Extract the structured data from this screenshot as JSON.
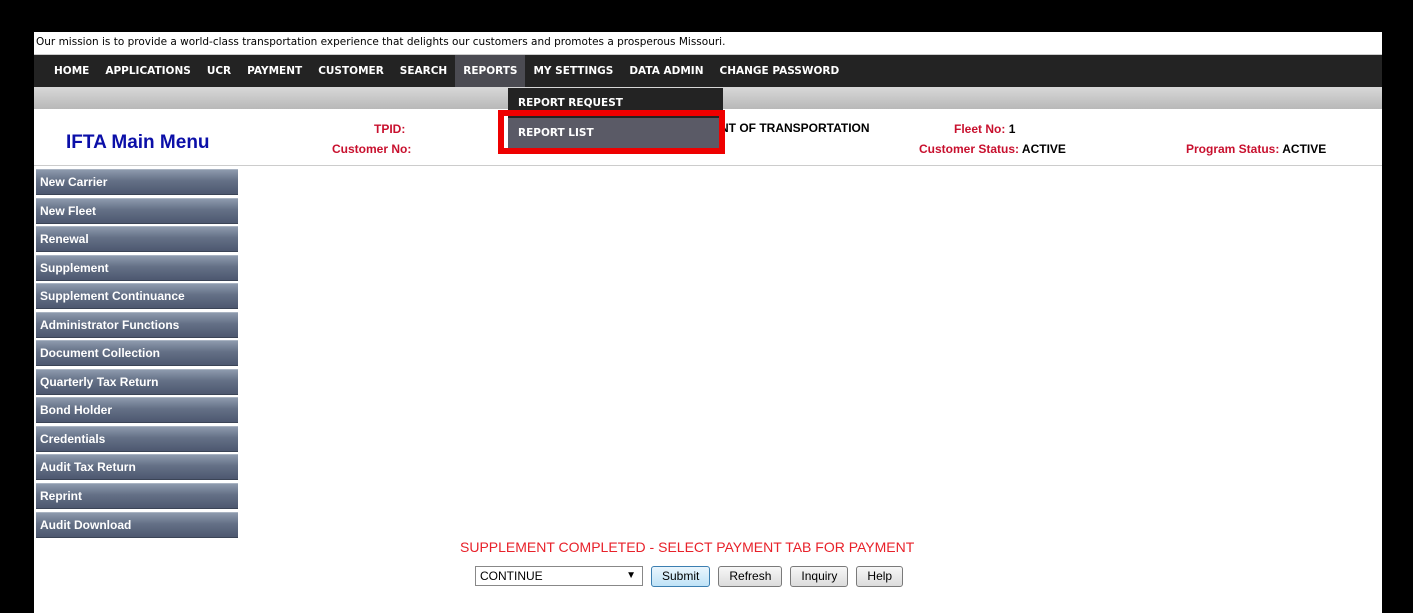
{
  "mission": "Our mission is to provide a world-class transportation experience that delights our customers and promotes a prosperous Missouri.",
  "nav": {
    "items": [
      "HOME",
      "APPLICATIONS",
      "UCR",
      "PAYMENT",
      "CUSTOMER",
      "SEARCH",
      "REPORTS",
      "MY SETTINGS",
      "DATA ADMIN",
      "CHANGE PASSWORD"
    ],
    "active": "REPORTS"
  },
  "dropdown": {
    "items": [
      "REPORT REQUEST",
      "REPORT LIST"
    ],
    "hovered": "REPORT LIST"
  },
  "header": {
    "title": "IFTA Main Menu",
    "tpid_label": "TPID:",
    "customer_no_label": "Customer No:",
    "dept_fragment": "NT OF TRANSPORTATION",
    "fleet_label": "Fleet No:",
    "fleet_value": "1",
    "customer_status_label": "Customer Status:",
    "customer_status_value": "ACTIVE",
    "program_status_label": "Program Status:",
    "program_status_value": "ACTIVE"
  },
  "sidebar": {
    "items": [
      "New Carrier",
      "New Fleet",
      "Renewal",
      "Supplement",
      "Supplement Continuance",
      "Administrator Functions",
      "Document Collection",
      "Quarterly Tax Return",
      "Bond Holder",
      "Credentials",
      "Audit Tax Return",
      "Reprint",
      "Audit Download"
    ]
  },
  "status_message": "SUPPLEMENT COMPLETED - SELECT PAYMENT TAB FOR PAYMENT",
  "controls": {
    "select_value": "CONTINUE",
    "submit": "Submit",
    "refresh": "Refresh",
    "inquiry": "Inquiry",
    "help": "Help"
  },
  "colors": {
    "nav_bg": "#232323",
    "title_blue": "#0b0fa8",
    "label_red": "#c8102e",
    "highlight": "#ee0000",
    "message_red": "#e8212a"
  }
}
